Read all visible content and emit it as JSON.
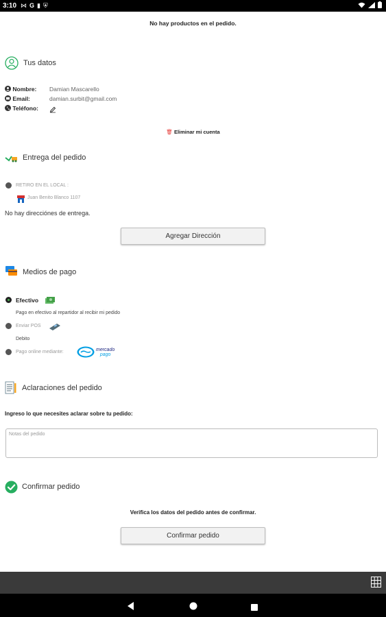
{
  "status_bar": {
    "time": "3:10",
    "left_icons": [
      "m-icon",
      "g-icon",
      "file-icon",
      "shield-icon"
    ],
    "right_icons": [
      "wifi-icon",
      "signal-icon",
      "battery-icon"
    ]
  },
  "cart": {
    "empty_message": "No hay productos en el pedido."
  },
  "user": {
    "title": "Tus datos",
    "name_label": "Nombre:",
    "name_value": "Damian Mascarello",
    "email_label": "Email:",
    "email_value": "damian.surbit@gmail.com",
    "phone_label": "Teléfono:",
    "delete_account": "Eliminar mi cuenta"
  },
  "delivery": {
    "title": "Entrega del pedido",
    "pickup_label": "RETIRO EN EL LOCAL :",
    "pickup_address": "Juan Benito Blanco 1107",
    "no_addresses": "No hay direcciónes de entrega.",
    "add_address_button": "Agregar Dirección"
  },
  "payment": {
    "title": "Medios de pago",
    "cash_label": "Efectivo",
    "cash_desc": "Pago en efectivo al repartidor al recibir mi pedido",
    "pos_label": "Enviar POS",
    "debit_label": "Debito",
    "online_label": "Pago online mediante:",
    "mp_logo_line1": "mercado",
    "mp_logo_line2": "pago",
    "selected": "Efectivo"
  },
  "notes": {
    "title": "Aclaraciones del pedido",
    "instruction": "Ingreso lo que necesites aclarar sobre tu pedido:",
    "placeholder": "Notas del pedido"
  },
  "confirm": {
    "title": "Confirmar pedido",
    "verify_text": "Verifica los datos del pedido antes de confirmar.",
    "button": "Confirmar pedido"
  },
  "colors": {
    "accent_green": "#27ae60",
    "delete_red": "#e53935",
    "mp_blue": "#009ee3",
    "bottom_bar": "#3a3a3a"
  }
}
